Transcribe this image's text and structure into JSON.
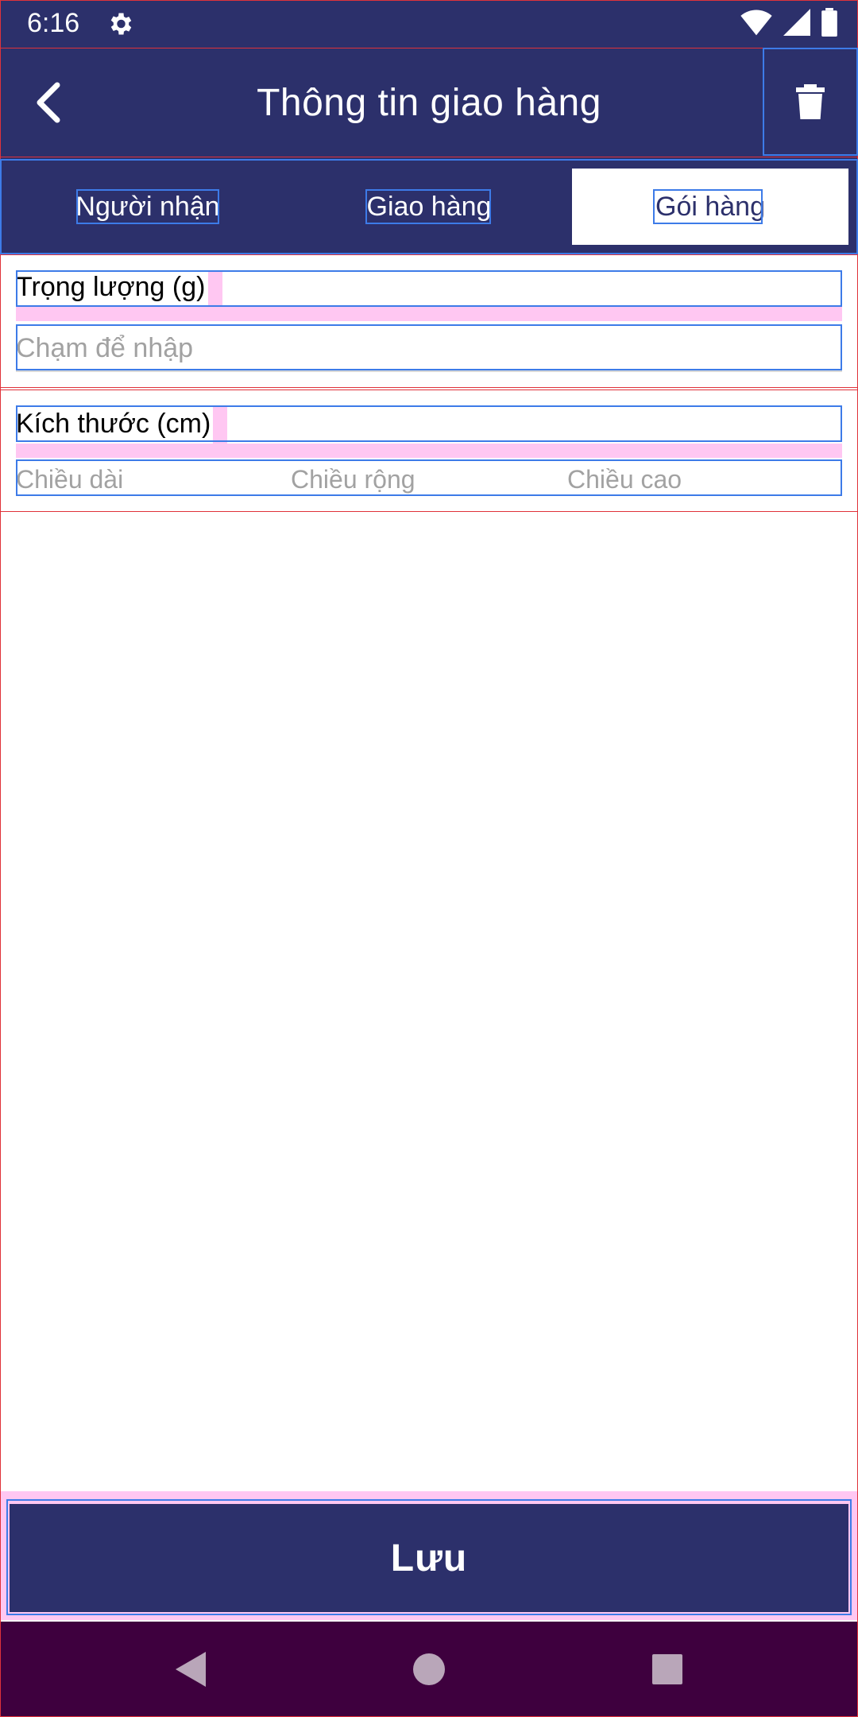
{
  "status": {
    "time": "6:16"
  },
  "appbar": {
    "title": "Thông tin giao hàng"
  },
  "tabs": [
    {
      "label": "Người nhận",
      "active": false
    },
    {
      "label": "Giao hàng",
      "active": false
    },
    {
      "label": "Gói hàng",
      "active": true
    }
  ],
  "weight": {
    "label": "Trọng lượng (g)",
    "placeholder": "Chạm để nhập"
  },
  "dimensions": {
    "label": "Kích thước (cm)",
    "length_placeholder": "Chiều dài",
    "width_placeholder": "Chiều rộng",
    "height_placeholder": "Chiều cao"
  },
  "save": {
    "label": "Lưu"
  },
  "colors": {
    "primary": "#2c306b",
    "overlay_pink": "#ffc7f2",
    "navbar": "#3e003e"
  }
}
